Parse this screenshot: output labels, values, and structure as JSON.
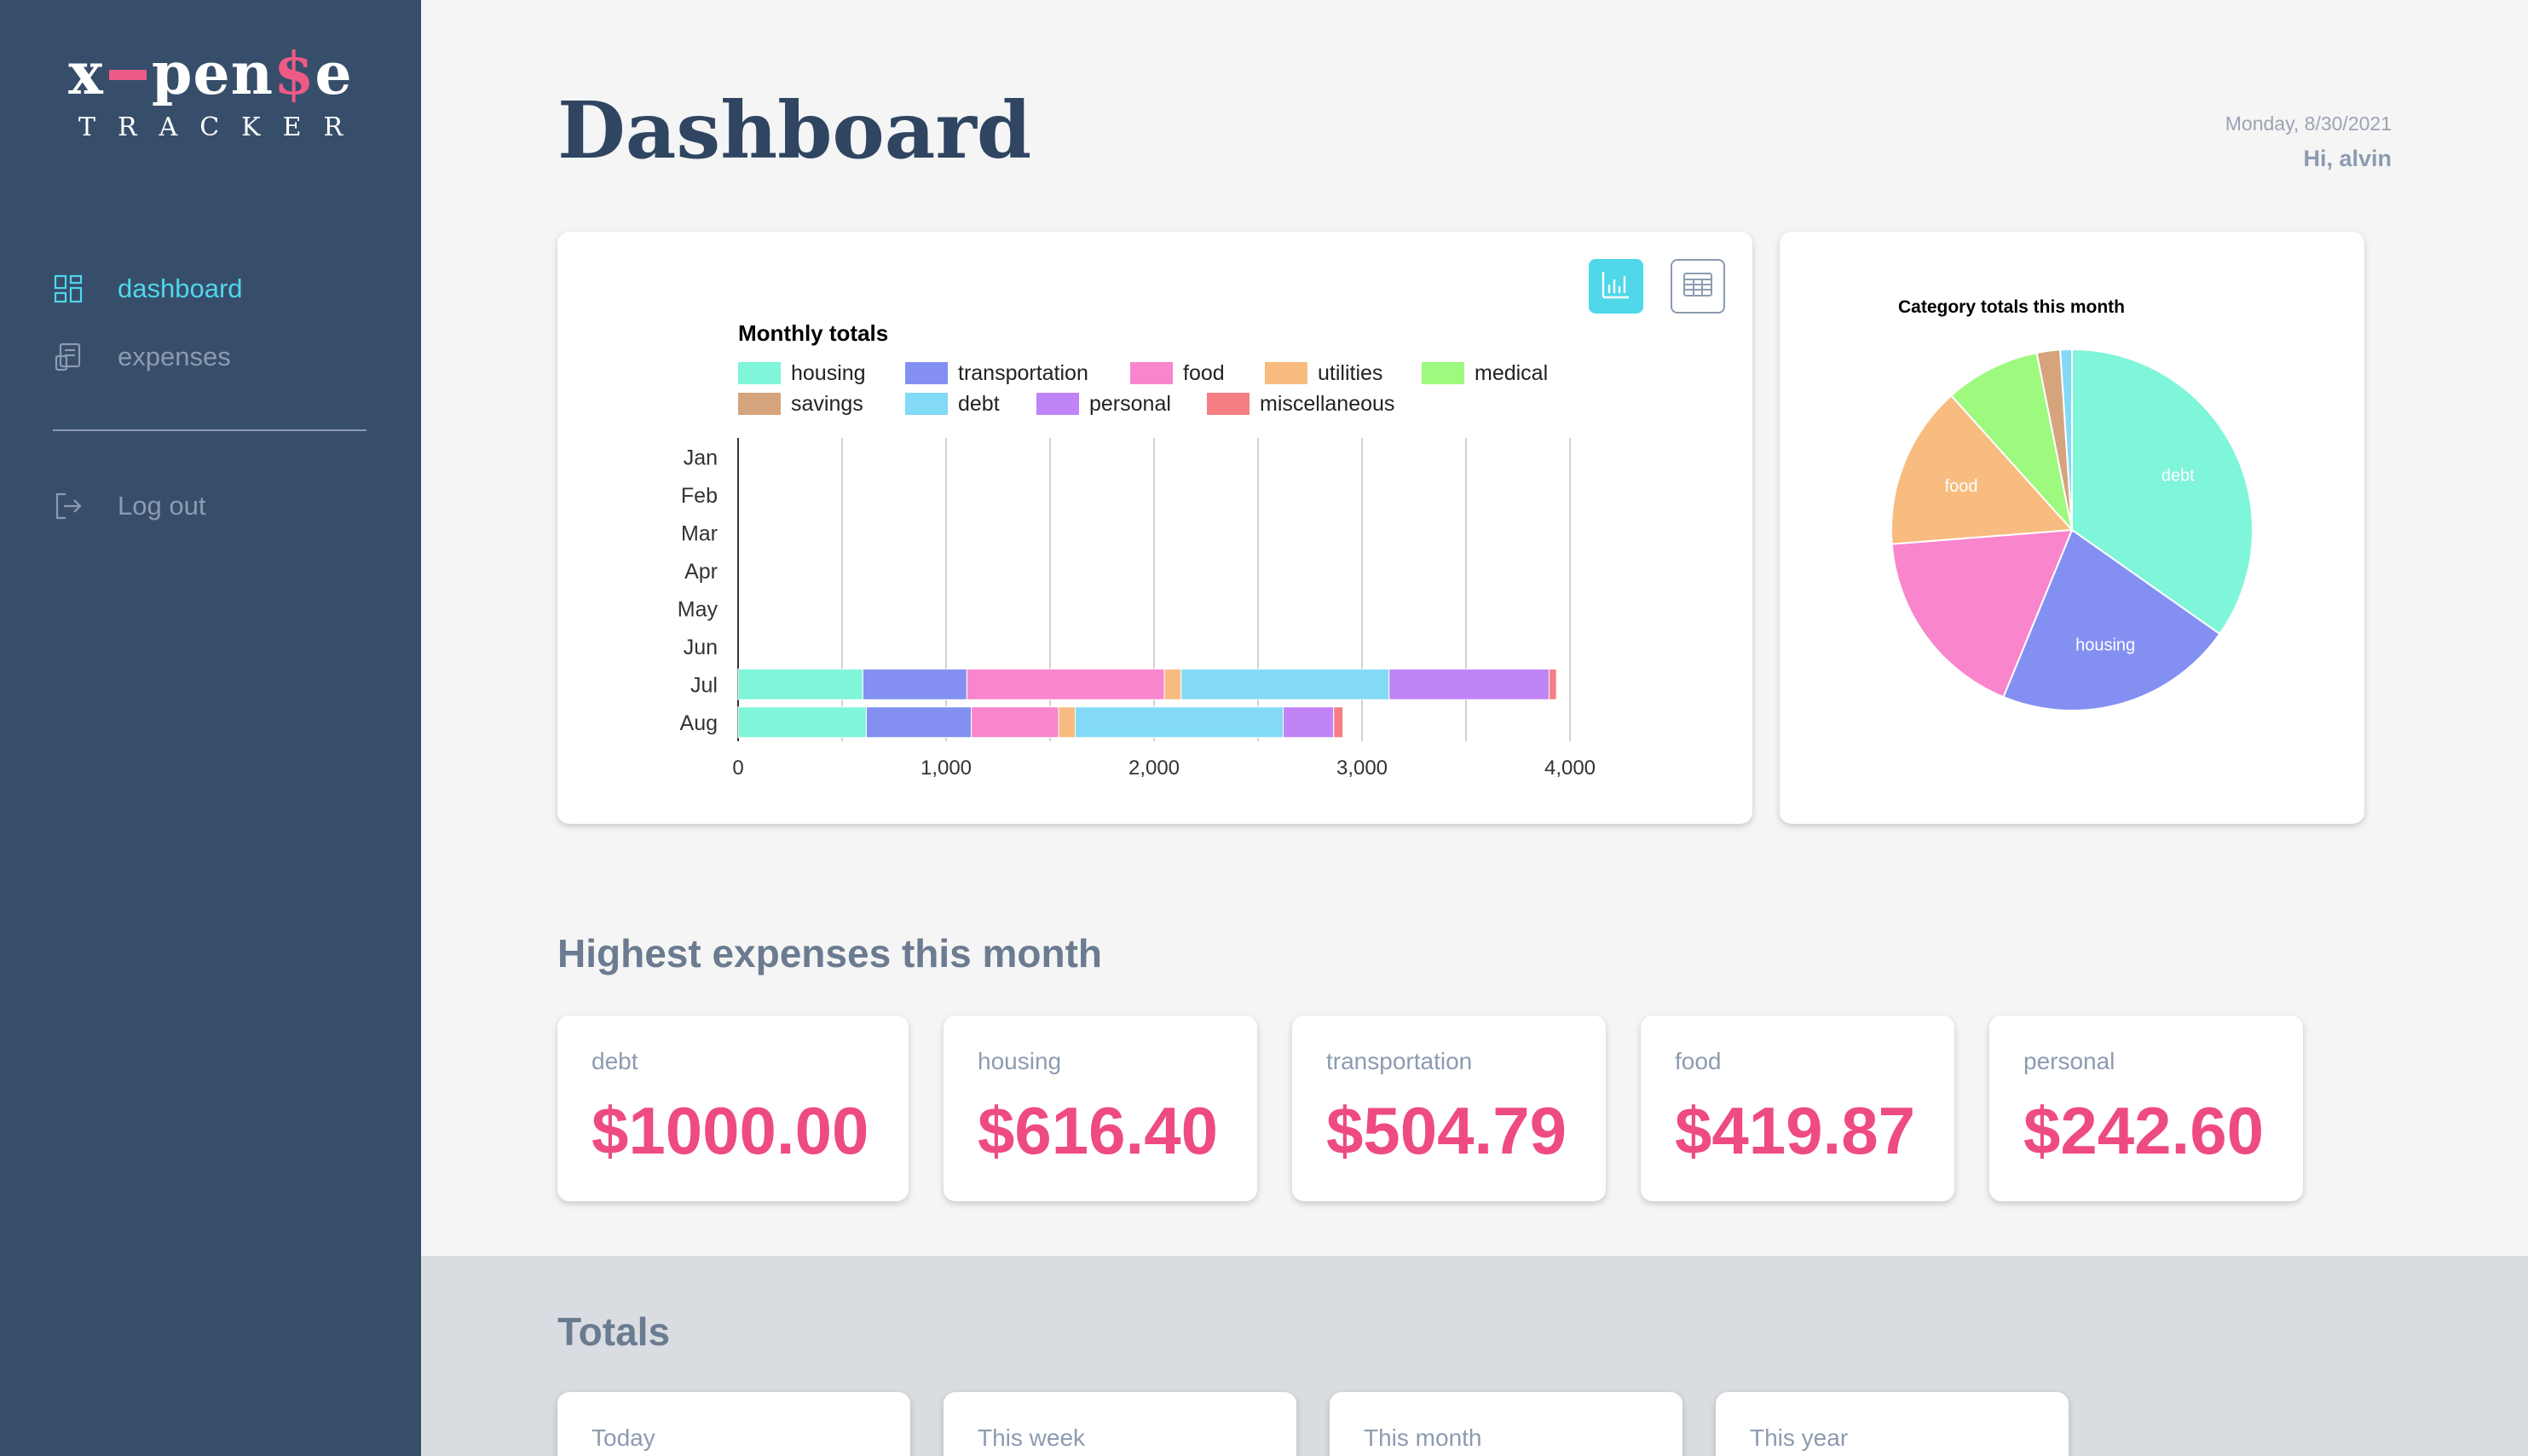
{
  "app": {
    "logo_left": "x",
    "logo_mid": "pen",
    "logo_dollar": "$",
    "logo_end": "e",
    "logo_sub": "TRACKER"
  },
  "nav": {
    "items": [
      {
        "label": "dashboard",
        "icon": "dashboard-icon",
        "active": true
      },
      {
        "label": "expenses",
        "icon": "receipt-icon",
        "active": false
      }
    ],
    "logout_label": "Log out"
  },
  "header": {
    "title": "Dashboard",
    "date": "Monday, 8/30/2021",
    "greeting": "Hi, alvin"
  },
  "colors": {
    "accent": "#4fd7ea",
    "sidebar": "#374e6b",
    "expense_value": "#ee4b83",
    "housing": "#7ff5d9",
    "transportation": "#8390f2",
    "food": "#f985cd",
    "utilities": "#f8bc80",
    "medical": "#9ef97f",
    "savings": "#d5a47d",
    "debt": "#82daf6",
    "personal": "#c184f7",
    "miscellaneous": "#f47e84"
  },
  "chart_data": [
    {
      "type": "bar",
      "orientation": "horizontal",
      "stacked": true,
      "title": "Monthly totals",
      "categories": [
        "Jan",
        "Feb",
        "Mar",
        "Apr",
        "May",
        "Jun",
        "Jul",
        "Aug"
      ],
      "xlim": [
        0,
        4000
      ],
      "xticks": [
        "0",
        "1,000",
        "2,000",
        "3,000",
        "4,000"
      ],
      "grid": true,
      "legend": "top",
      "series": [
        {
          "name": "housing",
          "values": [
            0,
            0,
            0,
            0,
            0,
            0,
            600,
            616.4
          ]
        },
        {
          "name": "transportation",
          "values": [
            0,
            0,
            0,
            0,
            0,
            0,
            500,
            504.79
          ]
        },
        {
          "name": "food",
          "values": [
            0,
            0,
            0,
            0,
            0,
            0,
            950,
            419.87
          ]
        },
        {
          "name": "utilities",
          "values": [
            0,
            0,
            0,
            0,
            0,
            0,
            80,
            80
          ]
        },
        {
          "name": "medical",
          "values": [
            0,
            0,
            0,
            0,
            0,
            0,
            0,
            0
          ]
        },
        {
          "name": "savings",
          "values": [
            0,
            0,
            0,
            0,
            0,
            0,
            0,
            0
          ]
        },
        {
          "name": "debt",
          "values": [
            0,
            0,
            0,
            0,
            0,
            0,
            1000,
            1000
          ]
        },
        {
          "name": "personal",
          "values": [
            0,
            0,
            0,
            0,
            0,
            0,
            770,
            242.6
          ]
        },
        {
          "name": "miscellaneous",
          "values": [
            0,
            0,
            0,
            0,
            0,
            0,
            35,
            45
          ]
        }
      ]
    },
    {
      "type": "pie",
      "title": "Category totals this month",
      "slices": [
        {
          "label": "debt",
          "value": 1000
        },
        {
          "label": "housing",
          "value": 616.4
        },
        {
          "label": "transportation",
          "value": 504.79
        },
        {
          "label": "food",
          "value": 419.87
        },
        {
          "label": "medical",
          "value": 245
        },
        {
          "label": "savings",
          "value": 60
        },
        {
          "label": "personal",
          "value": 30
        }
      ],
      "slice_colors": [
        "#7ff5d9",
        "#8390f2",
        "#f985cd",
        "#f8bc80",
        "#9ef97f",
        "#d5a47d",
        "#82daf6"
      ],
      "visible_labels": [
        "debt",
        "housing",
        "food"
      ]
    }
  ],
  "highest": {
    "title": "Highest expenses this month",
    "cards": [
      {
        "label": "debt",
        "value": "$1000.00"
      },
      {
        "label": "housing",
        "value": "$616.40"
      },
      {
        "label": "transportation",
        "value": "$504.79"
      },
      {
        "label": "food",
        "value": "$419.87"
      },
      {
        "label": "personal",
        "value": "$242.60"
      }
    ]
  },
  "totals": {
    "title": "Totals",
    "cards": [
      {
        "label": "Today"
      },
      {
        "label": "This week"
      },
      {
        "label": "This month"
      },
      {
        "label": "This year"
      }
    ]
  }
}
